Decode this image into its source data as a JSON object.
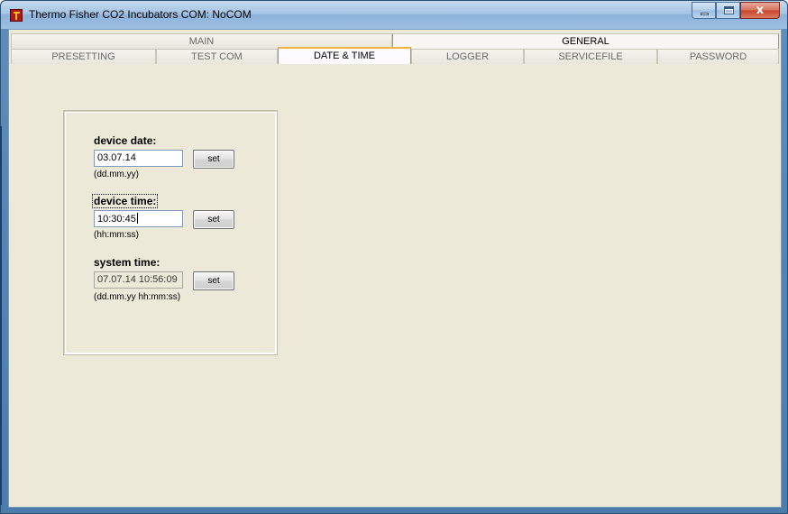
{
  "window": {
    "title": "Thermo Fisher CO2 Incubators COM: NoCOM",
    "close_glyph": "x"
  },
  "tabs_row1": [
    {
      "label": "MAIN",
      "selected": false
    },
    {
      "label": "GENERAL",
      "selected": true
    }
  ],
  "tabs_row2": [
    {
      "label": "PRESETTING",
      "selected": false
    },
    {
      "label": "TEST COM",
      "selected": false
    },
    {
      "label": "DATE & TIME",
      "selected": true
    },
    {
      "label": "LOGGER",
      "selected": false
    },
    {
      "label": "SERVICEFILE",
      "selected": false
    },
    {
      "label": "PASSWORD",
      "selected": false
    }
  ],
  "device_date": {
    "label": "device date:",
    "value": "03.07.14",
    "hint": "(dd.mm.yy)",
    "button": "set"
  },
  "device_time": {
    "label": "device time:",
    "value": "10:30:45",
    "hint": "(hh:mm:ss)",
    "button": "set"
  },
  "system_time": {
    "label": "system time:",
    "value": "07.07.14 10:56:09",
    "hint": "(dd.mm.yy hh:mm:ss)",
    "button": "set"
  },
  "icons": {
    "app": "thermo-fisher-logo-icon",
    "minimize": "minimize-icon",
    "maximize": "maximize-icon",
    "close": "close-icon"
  }
}
